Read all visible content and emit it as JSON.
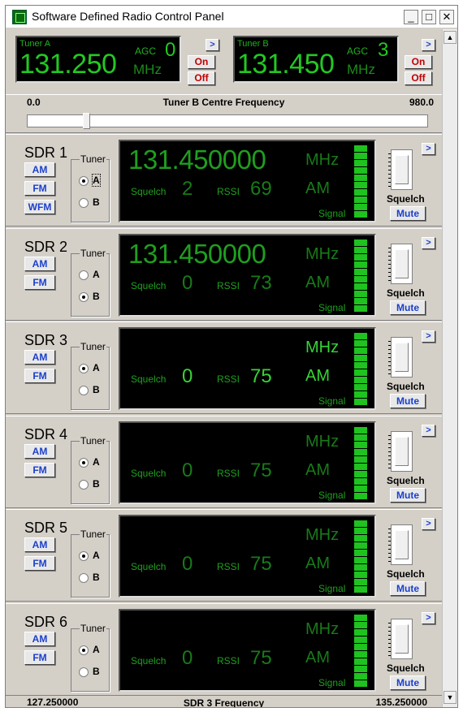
{
  "window": {
    "title": "Software Defined Radio Control Panel",
    "min": "_",
    "max": "□",
    "close": "✕"
  },
  "tuner_a": {
    "label": "Tuner A",
    "freq": "131.250",
    "agc_label": "AGC",
    "agc_value": "0",
    "unit": "MHz",
    "on": "On",
    "off": "Off",
    "arrow": ">"
  },
  "tuner_b": {
    "label": "Tuner B",
    "freq": "131.450",
    "agc_label": "AGC",
    "agc_value": "3",
    "unit": "MHz",
    "on": "On",
    "off": "Off",
    "arrow": ">"
  },
  "centre_slider": {
    "min": "0.0",
    "title": "Tuner B Centre Frequency",
    "max": "980.0",
    "value_fraction": 0.14
  },
  "sdr_common": {
    "tuner_group": "Tuner",
    "opt_a": "A",
    "opt_b": "B",
    "squelch_label": "Squelch",
    "rssi_label": "RSSI",
    "signal_label": "Signal",
    "mhz": "MHz",
    "squelch_caption": "Squelch",
    "mute": "Mute",
    "arrow": ">"
  },
  "sdrs": [
    {
      "name": "SDR 1",
      "modes": [
        "AM",
        "FM",
        "WFM"
      ],
      "tuner": "A",
      "freq": "131.450000",
      "squelch": "2",
      "rssi": "69",
      "mode": "AM",
      "lit_segments": 10,
      "active": false
    },
    {
      "name": "SDR 2",
      "modes": [
        "AM",
        "FM"
      ],
      "tuner": "B",
      "freq": "131.450000",
      "squelch": "0",
      "rssi": "73",
      "mode": "AM",
      "lit_segments": 10,
      "active": false
    },
    {
      "name": "SDR 3",
      "modes": [
        "AM",
        "FM"
      ],
      "tuner": "A",
      "freq": "",
      "squelch": "0",
      "rssi": "75",
      "mode": "AM",
      "lit_segments": 10,
      "active": true
    },
    {
      "name": "SDR 4",
      "modes": [
        "AM",
        "FM"
      ],
      "tuner": "A",
      "freq": "",
      "squelch": "0",
      "rssi": "75",
      "mode": "AM",
      "lit_segments": 10,
      "active": false
    },
    {
      "name": "SDR 5",
      "modes": [
        "AM",
        "FM"
      ],
      "tuner": "A",
      "freq": "",
      "squelch": "0",
      "rssi": "75",
      "mode": "AM",
      "lit_segments": 10,
      "active": false
    },
    {
      "name": "SDR 6",
      "modes": [
        "AM",
        "FM"
      ],
      "tuner": "A",
      "freq": "",
      "squelch": "0",
      "rssi": "75",
      "mode": "AM",
      "lit_segments": 10,
      "active": false
    }
  ],
  "status": {
    "left": "127.250000",
    "center": "SDR 3 Frequency",
    "right": "135.250000"
  },
  "colors": {
    "lcd_green": "#22c922",
    "panel": "#d4d0c8",
    "mode_blue": "#1a3fcc",
    "onoff_red": "#c00000"
  }
}
